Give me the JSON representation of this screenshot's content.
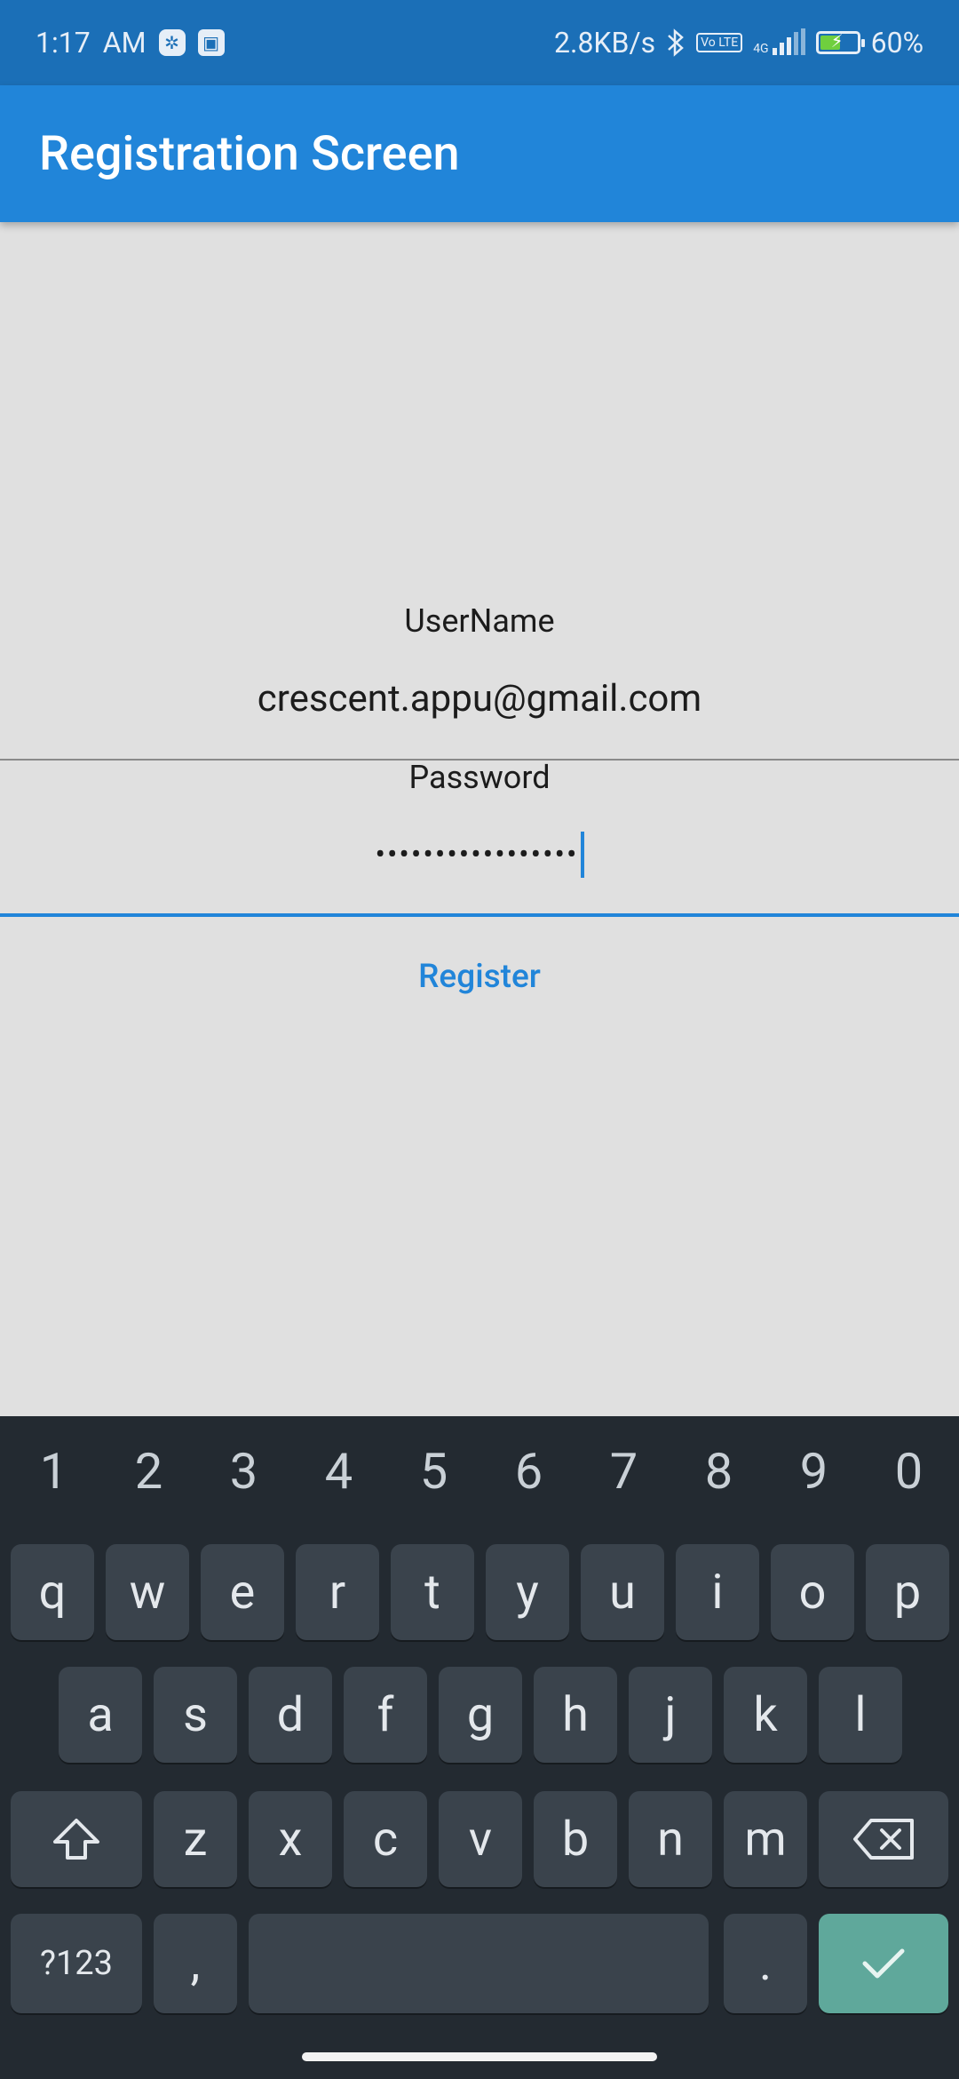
{
  "status_bar": {
    "time": "1:17",
    "ampm": "AM",
    "speed": "2.8KB/s",
    "network": "4G",
    "volte": "Vo LTE",
    "battery": "60%",
    "battery_level": 0.6
  },
  "app_bar": {
    "title": "Registration Screen"
  },
  "form": {
    "username_label": "UserName",
    "username_value": "crescent.appu@gmail.com",
    "password_label": "Password",
    "password_masked": "•••••••••••••••••",
    "register_label": "Register"
  },
  "keyboard": {
    "numbers": [
      "1",
      "2",
      "3",
      "4",
      "5",
      "6",
      "7",
      "8",
      "9",
      "0"
    ],
    "row1": [
      "q",
      "w",
      "e",
      "r",
      "t",
      "y",
      "u",
      "i",
      "o",
      "p"
    ],
    "row2": [
      "a",
      "s",
      "d",
      "f",
      "g",
      "h",
      "j",
      "k",
      "l"
    ],
    "row3": [
      "z",
      "x",
      "c",
      "v",
      "b",
      "n",
      "m"
    ],
    "symbols_label": "?123",
    "comma": ",",
    "period": "."
  },
  "colors": {
    "app_bar": "#2185d9",
    "status_bar": "#1b6fb7",
    "background": "#e0e0e0",
    "keyboard": "#232a31",
    "accent": "#2185d9"
  }
}
